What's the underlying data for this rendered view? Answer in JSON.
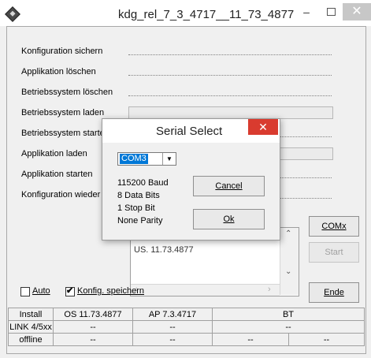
{
  "window": {
    "title": "kdg_rel_7_3_4717__11_73_4877",
    "minimize_glyph": "–",
    "close_glyph": "✕"
  },
  "rows": [
    {
      "label": "Konfiguration sichern"
    },
    {
      "label": "Applikation löschen"
    },
    {
      "label": "Betriebssystem löschen"
    },
    {
      "label": "Betriebssystem laden"
    },
    {
      "label": "Betriebssystem starte"
    },
    {
      "label": "Applikation laden"
    },
    {
      "label": "Applikation starten"
    },
    {
      "label": "Konfiguration wieder"
    }
  ],
  "list": {
    "partial_item": "US. 11.73.4877"
  },
  "buttons": {
    "comx": "COMx",
    "start": "Start",
    "ende": "Ende"
  },
  "checkboxes": {
    "auto": {
      "label": "Auto",
      "checked": false
    },
    "konfig": {
      "label": "Konfig. speichern",
      "checked": true
    }
  },
  "status": {
    "row1": [
      "Install",
      "OS 11.73.4877",
      "AP 7.3.4717",
      "BT"
    ],
    "row2": [
      "LINK 4/5xx",
      "--",
      "--",
      "--"
    ],
    "row3": [
      "offline",
      "--",
      "--",
      "--",
      "--"
    ]
  },
  "dialog": {
    "title": "Serial Select",
    "close_glyph": "✕",
    "port": "COM3",
    "baud": "115200 Baud",
    "data_bits": "8 Data Bits",
    "stop_bit": "1 Stop Bit",
    "parity": "None Parity",
    "cancel_label": "Cancel",
    "ok_label": "Ok"
  },
  "icons": [
    "app-icon",
    "chevron-down-icon",
    "scroll-up-icon",
    "scroll-down-icon",
    "scroll-left-icon",
    "scroll-right-icon",
    "check-icon"
  ]
}
